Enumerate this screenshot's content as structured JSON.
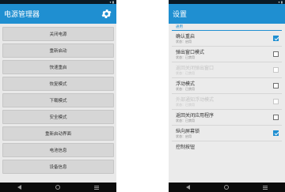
{
  "left": {
    "app_title": "电源管理器",
    "settings_icon": "gear-icon",
    "buttons": [
      {
        "label": "关闭电源"
      },
      {
        "label": "重新启动"
      },
      {
        "label": "快速重启"
      },
      {
        "label": "恢复模式"
      },
      {
        "label": "下载模式"
      },
      {
        "label": "安全模式"
      },
      {
        "label": "重新启动界面"
      },
      {
        "label": "电池信息"
      },
      {
        "label": "设备信息"
      }
    ]
  },
  "right": {
    "title": "设置",
    "section": "通用",
    "items": [
      {
        "title": "确认重启",
        "summary": "状态：启用",
        "checked": true,
        "enabled": true
      },
      {
        "title": "弹出窗口模式",
        "summary": "状态：已禁用",
        "checked": false,
        "enabled": true
      },
      {
        "title": "返回关闭弹出窗口",
        "summary": "状态：已禁用",
        "checked": false,
        "enabled": false
      },
      {
        "title": "浮动模式",
        "summary": "状态：已禁用",
        "checked": false,
        "enabled": true
      },
      {
        "title": "外部通知浮动模式",
        "summary": "状态：已禁用",
        "checked": false,
        "enabled": false
      },
      {
        "title": "返回关闭应用程序",
        "summary": "状态：已禁用",
        "checked": false,
        "enabled": true
      },
      {
        "title": "纵向屏幕锁",
        "summary": "状态：启用",
        "checked": true,
        "enabled": true
      }
    ],
    "next_group": "控制按钮"
  },
  "colors": {
    "accent": "#1f8fd1",
    "status_bar": "#0a1a26",
    "nav_bar": "#0c0c0c",
    "button_bg": "#d6d6d6",
    "screen_bg": "#e9e9e9"
  }
}
